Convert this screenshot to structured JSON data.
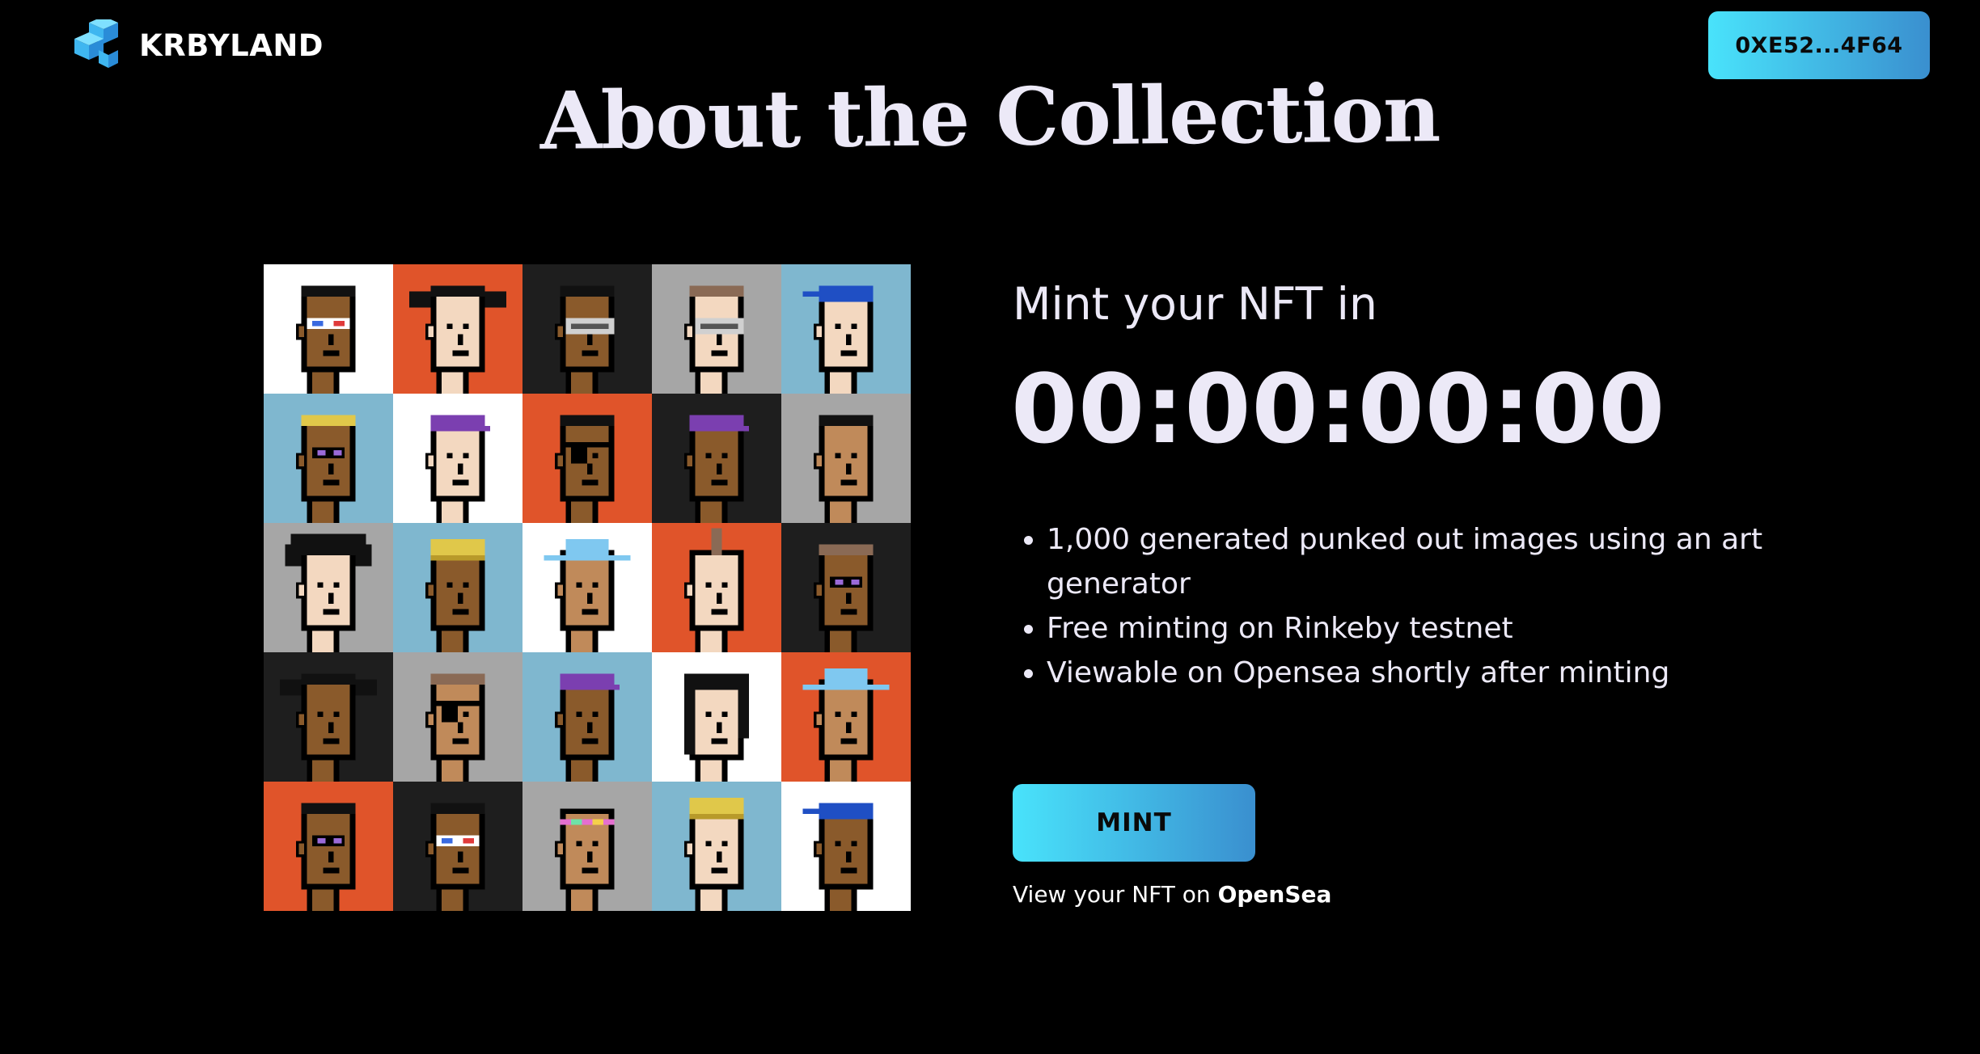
{
  "header": {
    "brand_name": "KRBYLAND",
    "logo_icon": "cube-logo-icon",
    "wallet_label": "0XE52...4F64"
  },
  "main": {
    "title": "About the Collection",
    "mint_heading": "Mint your NFT in",
    "countdown": "00:00:00:00",
    "features": [
      "1,000 generated punked out images using an art generator",
      "Free minting on Rinkeby testnet",
      "Viewable on Opensea shortly after minting"
    ],
    "mint_button": "MINT",
    "view_prefix": "View your NFT on",
    "view_link": "OpenSea"
  },
  "colors": {
    "background": "#000000",
    "text": "#ece9f7",
    "accent_start": "#49e3fb",
    "accent_end": "#3a8fcf"
  },
  "grid": {
    "tiles": [
      {
        "bg": "#ffffff",
        "skin": "#8a5a2b",
        "hair": "#111111",
        "acc": "3d"
      },
      {
        "bg": "#e0542a",
        "skin": "#f3d8c0",
        "hair": "#111111",
        "acc": "pigtails"
      },
      {
        "bg": "#1e1e1e",
        "skin": "#8a5a2b",
        "hair": "#111111",
        "acc": "vr"
      },
      {
        "bg": "#a6a6a6",
        "skin": "#f3d8c0",
        "hair": "#8a6a55",
        "acc": "vr"
      },
      {
        "bg": "#7fb7cf",
        "skin": "#f3d8c0",
        "hair": "#1f4fc4",
        "acc": "bandana"
      },
      {
        "bg": "#7fb7cf",
        "skin": "#8a5a2b",
        "hair": "#e0c84a",
        "acc": "shades"
      },
      {
        "bg": "#ffffff",
        "skin": "#f3d8c0",
        "hair": "#7b3fb0",
        "acc": "cap"
      },
      {
        "bg": "#e0542a",
        "skin": "#8a5a2b",
        "hair": "#111111",
        "acc": "eyepatch"
      },
      {
        "bg": "#1e1e1e",
        "skin": "#8a5a2b",
        "hair": "#7b3fb0",
        "acc": "cap"
      },
      {
        "bg": "#a6a6a6",
        "skin": "#c08a5a",
        "hair": "#111111",
        "acc": "none"
      },
      {
        "bg": "#a6a6a6",
        "skin": "#f3d8c0",
        "hair": "#111111",
        "acc": "wild"
      },
      {
        "bg": "#7fb7cf",
        "skin": "#8a5a2b",
        "hair": "#e0c84a",
        "acc": "beanie"
      },
      {
        "bg": "#ffffff",
        "skin": "#c08a5a",
        "hair": "#7fc8f0",
        "acc": "cowboy"
      },
      {
        "bg": "#e0542a",
        "skin": "#f3d8c0",
        "hair": "#8a6a55",
        "acc": "mohawk"
      },
      {
        "bg": "#1e1e1e",
        "skin": "#8a5a2b",
        "hair": "#8a6a55",
        "acc": "shades"
      },
      {
        "bg": "#1e1e1e",
        "skin": "#8a5a2b",
        "hair": "#111111",
        "acc": "pigtails"
      },
      {
        "bg": "#a6a6a6",
        "skin": "#c08a5a",
        "hair": "#8a6a55",
        "acc": "eyepatch"
      },
      {
        "bg": "#7fb7cf",
        "skin": "#8a5a2b",
        "hair": "#7b3fb0",
        "acc": "cap"
      },
      {
        "bg": "#ffffff",
        "skin": "#f3d8c0",
        "hair": "#111111",
        "acc": "long"
      },
      {
        "bg": "#e0542a",
        "skin": "#c08a5a",
        "hair": "#7fc8f0",
        "acc": "cowboy"
      },
      {
        "bg": "#e0542a",
        "skin": "#8a5a2b",
        "hair": "#111111",
        "acc": "shades"
      },
      {
        "bg": "#1e1e1e",
        "skin": "#8a5a2b",
        "hair": "#111111",
        "acc": "3d"
      },
      {
        "bg": "#a6a6a6",
        "skin": "#c08a5a",
        "hair": "#e46fd0",
        "acc": "headband"
      },
      {
        "bg": "#7fb7cf",
        "skin": "#f3d8c0",
        "hair": "#e0c84a",
        "acc": "beanie"
      },
      {
        "bg": "#ffffff",
        "skin": "#8a5a2b",
        "hair": "#1f4fc4",
        "acc": "bandana"
      }
    ]
  }
}
